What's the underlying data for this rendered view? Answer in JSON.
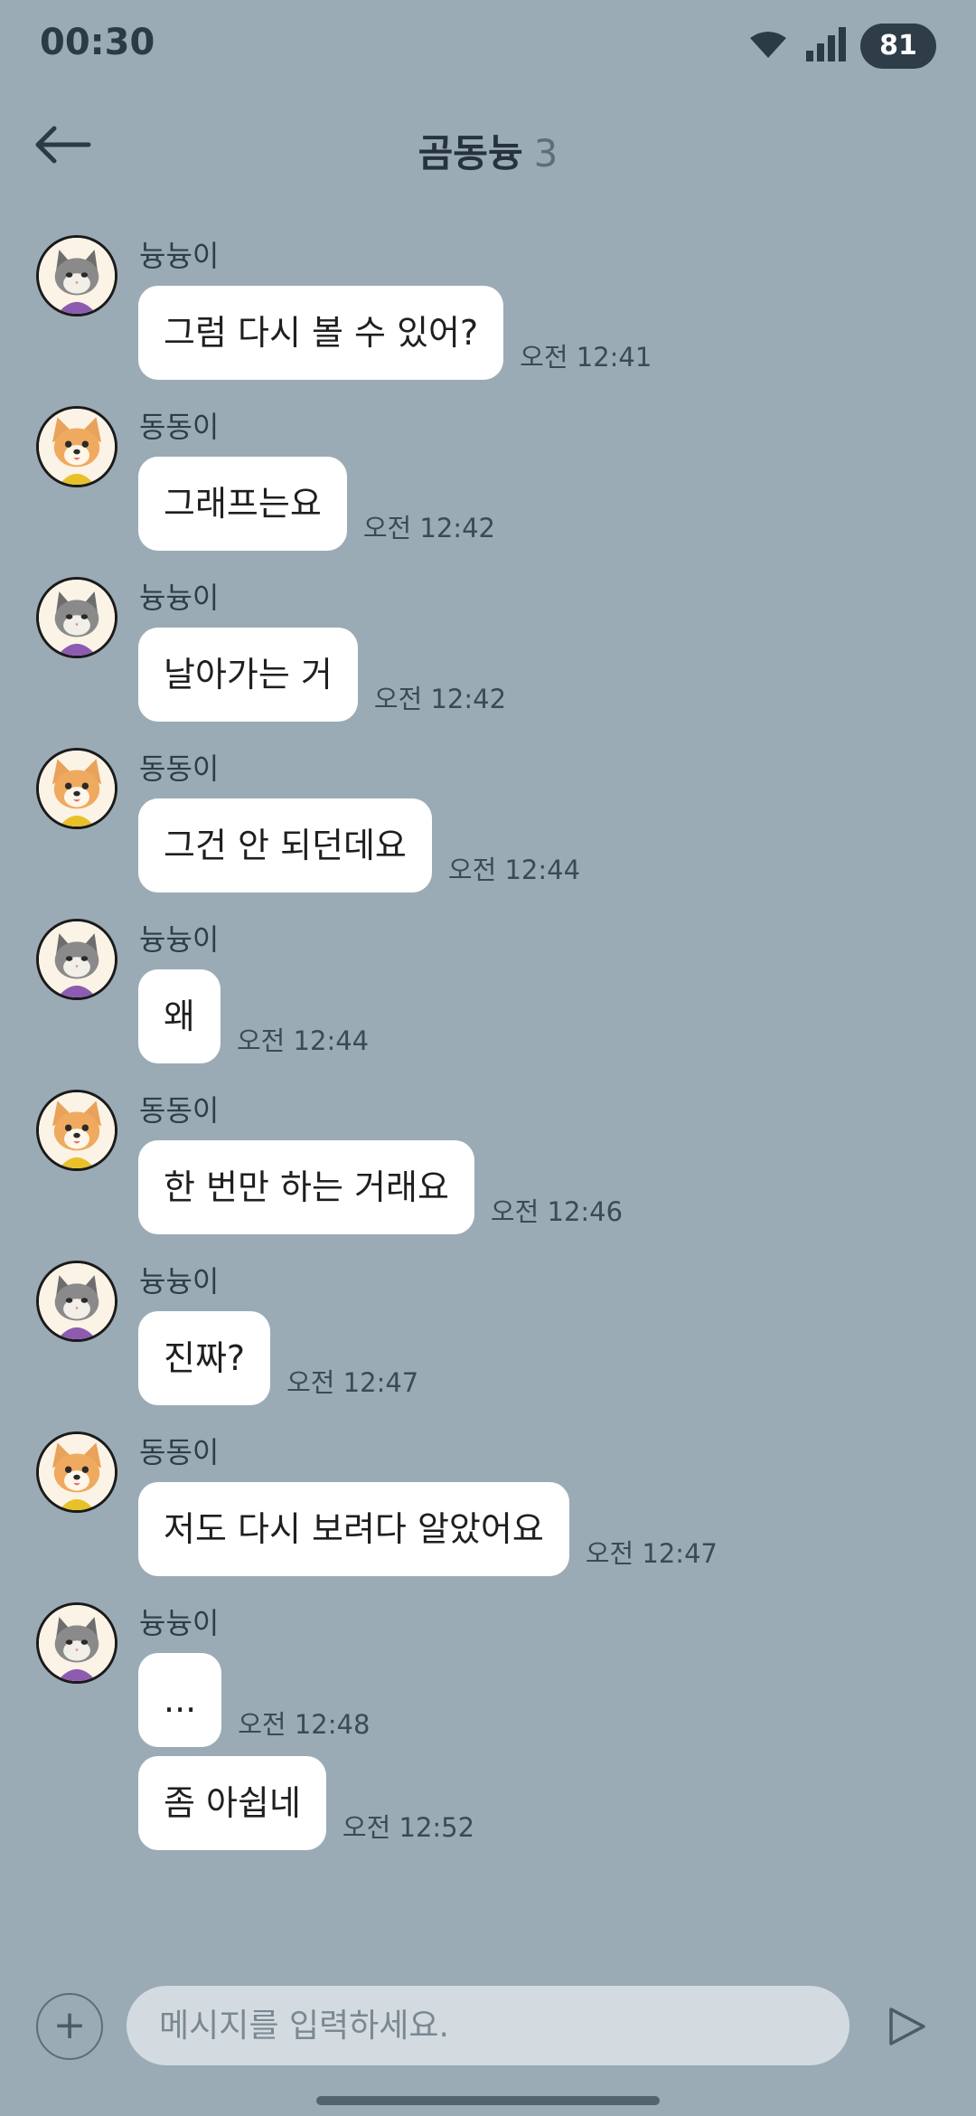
{
  "status": {
    "time": "00:30",
    "battery": "81"
  },
  "header": {
    "title": "곰동늉",
    "member_count": "3"
  },
  "messages": [
    {
      "sender": "늉늉이",
      "avatar": "cat",
      "text": "그럼 다시 볼 수 있어?",
      "time": "오전 12:41"
    },
    {
      "sender": "동동이",
      "avatar": "dog",
      "text": "그래프는요",
      "time": "오전 12:42"
    },
    {
      "sender": "늉늉이",
      "avatar": "cat",
      "text": "날아가는 거",
      "time": "오전 12:42"
    },
    {
      "sender": "동동이",
      "avatar": "dog",
      "text": "그건 안 되던데요",
      "time": "오전 12:44"
    },
    {
      "sender": "늉늉이",
      "avatar": "cat",
      "text": "왜",
      "time": "오전 12:44"
    },
    {
      "sender": "동동이",
      "avatar": "dog",
      "text": "한 번만 하는 거래요",
      "time": "오전 12:46"
    },
    {
      "sender": "늉늉이",
      "avatar": "cat",
      "text": "진짜?",
      "time": "오전 12:47"
    },
    {
      "sender": "동동이",
      "avatar": "dog",
      "text": "저도 다시 보려다 알았어요",
      "time": "오전 12:47"
    },
    {
      "sender": "늉늉이",
      "avatar": "cat",
      "text": "...",
      "time": "오전 12:48"
    },
    {
      "sender": "늉늉이",
      "avatar": "cat",
      "text": "좀 아쉽네",
      "time": "오전 12:52"
    }
  ],
  "composer": {
    "placeholder": "메시지를 입력하세요."
  },
  "icons": {
    "back": "back-arrow-icon",
    "plus": "plus-icon",
    "send": "send-icon",
    "wifi": "wifi-icon",
    "signal": "signal-icon",
    "avatar_cat": "cat-avatar",
    "avatar_dog": "dog-avatar"
  },
  "colors": {
    "background": "#9aabb5",
    "bubble": "#ffffff",
    "input": "#d3dbe1",
    "battery": "#2e3d47"
  }
}
